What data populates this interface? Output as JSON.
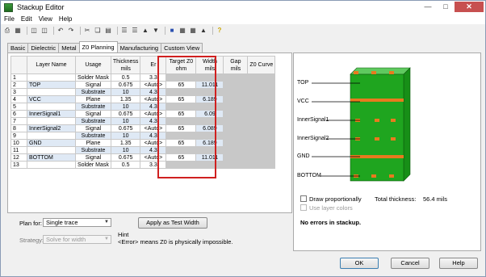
{
  "window": {
    "title": "Stackup Editor"
  },
  "menu": [
    "File",
    "Edit",
    "View",
    "Help"
  ],
  "tabs": [
    "Basic",
    "Dielectric",
    "Metal",
    "Z0 Planning",
    "Manufacturing",
    "Custom View"
  ],
  "active_tab": "Z0 Planning",
  "columns": {
    "num": "",
    "layer_name": "Layer Name",
    "usage": "Usage",
    "thickness": "Thickness\nmils",
    "er": "Er",
    "target_z0": "Target Z0\nohm",
    "width": "Width\nmils",
    "gap": "Gap\nmils",
    "z0_curve": "Z0 Curve"
  },
  "rows": [
    {
      "num": "1",
      "name": "",
      "usage": "Solder Mask",
      "thk": "0.5",
      "er": "3.3",
      "tz": "",
      "wm": ""
    },
    {
      "num": "2",
      "name": "TOP",
      "usage": "Signal",
      "thk": "0.675",
      "er": "<Auto>",
      "tz": "65",
      "wm": "11.011"
    },
    {
      "num": "3",
      "name": "",
      "usage": "Substrate",
      "thk": "10",
      "er": "4.3",
      "tz": "",
      "wm": ""
    },
    {
      "num": "4",
      "name": "VCC",
      "usage": "Plane",
      "thk": "1.35",
      "er": "<Auto>",
      "tz": "65",
      "wm": "6.189"
    },
    {
      "num": "5",
      "name": "",
      "usage": "Substrate",
      "thk": "10",
      "er": "4.3",
      "tz": "",
      "wm": ""
    },
    {
      "num": "6",
      "name": "InnerSignal1",
      "usage": "Signal",
      "thk": "0.675",
      "er": "<Auto>",
      "tz": "65",
      "wm": "6.09"
    },
    {
      "num": "7",
      "name": "",
      "usage": "Substrate",
      "thk": "10",
      "er": "4.3",
      "tz": "",
      "wm": ""
    },
    {
      "num": "8",
      "name": "InnerSignal2",
      "usage": "Signal",
      "thk": "0.675",
      "er": "<Auto>",
      "tz": "65",
      "wm": "6.089"
    },
    {
      "num": "9",
      "name": "",
      "usage": "Substrate",
      "thk": "10",
      "er": "4.3",
      "tz": "",
      "wm": ""
    },
    {
      "num": "10",
      "name": "GND",
      "usage": "Plane",
      "thk": "1.35",
      "er": "<Auto>",
      "tz": "65",
      "wm": "6.189"
    },
    {
      "num": "11",
      "name": "",
      "usage": "Substrate",
      "thk": "10",
      "er": "4.3",
      "tz": "",
      "wm": ""
    },
    {
      "num": "12",
      "name": "BOTTOM",
      "usage": "Signal",
      "thk": "0.675",
      "er": "<Auto>",
      "tz": "65",
      "wm": "11.011"
    },
    {
      "num": "13",
      "name": "",
      "usage": "Solder Mask",
      "thk": "0.5",
      "er": "3.3",
      "tz": "",
      "wm": ""
    }
  ],
  "plan_for": {
    "label": "Plan for:",
    "value": "Single trace"
  },
  "strategy": {
    "label": "Strategy:",
    "value": "Solve for width"
  },
  "apply_button": "Apply as Test Width",
  "hint": {
    "title": "Hint",
    "text": "<Error> means Z0 is physically impossible."
  },
  "stackup_labels": [
    "TOP",
    "VCC",
    "InnerSignal1",
    "InnerSignal2",
    "GND",
    "BOTTOM"
  ],
  "draw_proportionally": "Draw proportionally",
  "use_layer_colors": "Use layer colors",
  "total_thickness": {
    "label": "Total thickness:",
    "value": "56.4 mils"
  },
  "status_message": "No errors in stackup.",
  "buttons": {
    "ok": "OK",
    "cancel": "Cancel",
    "help": "Help"
  },
  "colors": {
    "pcb_green": "#1fa51f",
    "copper": "#e87a1e",
    "highlight_red": "#d02020"
  }
}
